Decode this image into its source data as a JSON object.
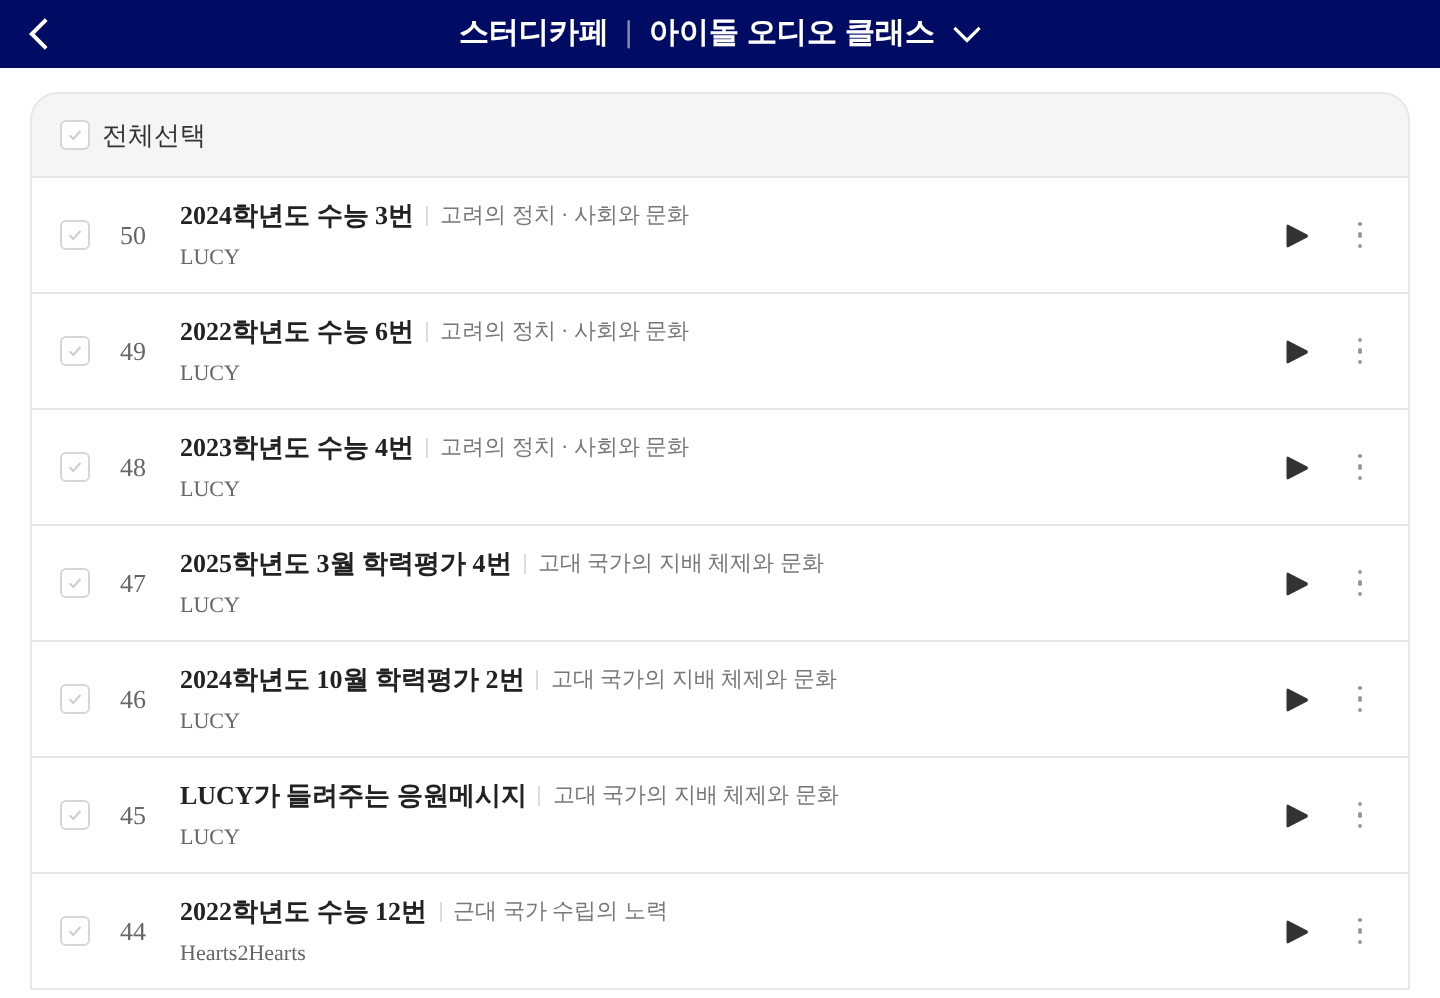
{
  "header": {
    "category": "스터디카페",
    "separator": "|",
    "title": "아이돌 오디오 클래스"
  },
  "select_all": {
    "label": "전체선택",
    "checked": false
  },
  "tracks": [
    {
      "number": "50",
      "title": "2024학년도 수능 3번",
      "topic": "고려의 정치 · 사회와 문화",
      "artist": "LUCY",
      "checked": false
    },
    {
      "number": "49",
      "title": "2022학년도 수능 6번",
      "topic": "고려의 정치 · 사회와 문화",
      "artist": "LUCY",
      "checked": false
    },
    {
      "number": "48",
      "title": "2023학년도 수능 4번",
      "topic": "고려의 정치 · 사회와 문화",
      "artist": "LUCY",
      "checked": false
    },
    {
      "number": "47",
      "title": "2025학년도 3월 학력평가 4번",
      "topic": "고대 국가의 지배 체제와 문화",
      "artist": "LUCY",
      "checked": false
    },
    {
      "number": "46",
      "title": "2024학년도 10월 학력평가 2번",
      "topic": "고대 국가의 지배 체제와 문화",
      "artist": "LUCY",
      "checked": false
    },
    {
      "number": "45",
      "title": "LUCY가 들려주는 응원메시지",
      "topic": "고대 국가의 지배 체제와 문화",
      "artist": "LUCY",
      "checked": false
    },
    {
      "number": "44",
      "title": "2022학년도 수능 12번",
      "topic": "근대 국가 수립의 노력",
      "artist": "Hearts2Hearts",
      "checked": false
    }
  ]
}
